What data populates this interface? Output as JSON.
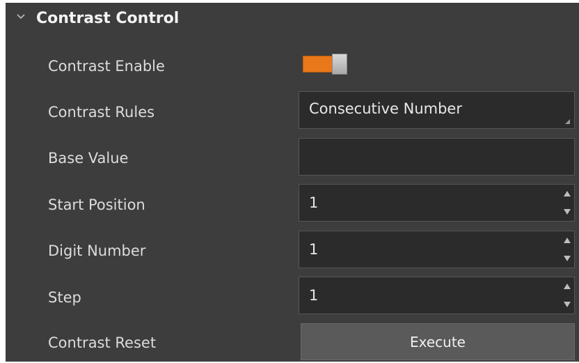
{
  "section": {
    "title": "Contrast Control",
    "icon": "chevron-down-icon"
  },
  "rows": {
    "contrast_enable": {
      "label": "Contrast Enable",
      "value": "on"
    },
    "contrast_rules": {
      "label": "Contrast Rules",
      "value": "Consecutive Number"
    },
    "base_value": {
      "label": "Base Value",
      "value": ""
    },
    "start_position": {
      "label": "Start Position",
      "value": "1"
    },
    "digit_number": {
      "label": "Digit Number",
      "value": "1"
    },
    "step": {
      "label": "Step",
      "value": "1"
    },
    "contrast_reset": {
      "label": "Contrast Reset",
      "button": "Execute"
    }
  },
  "colors": {
    "panel_bg": "#3d3d3d",
    "field_bg": "#2b2b2b",
    "toggle_on": "#e8781a",
    "button_bg": "#5a5a5a"
  }
}
